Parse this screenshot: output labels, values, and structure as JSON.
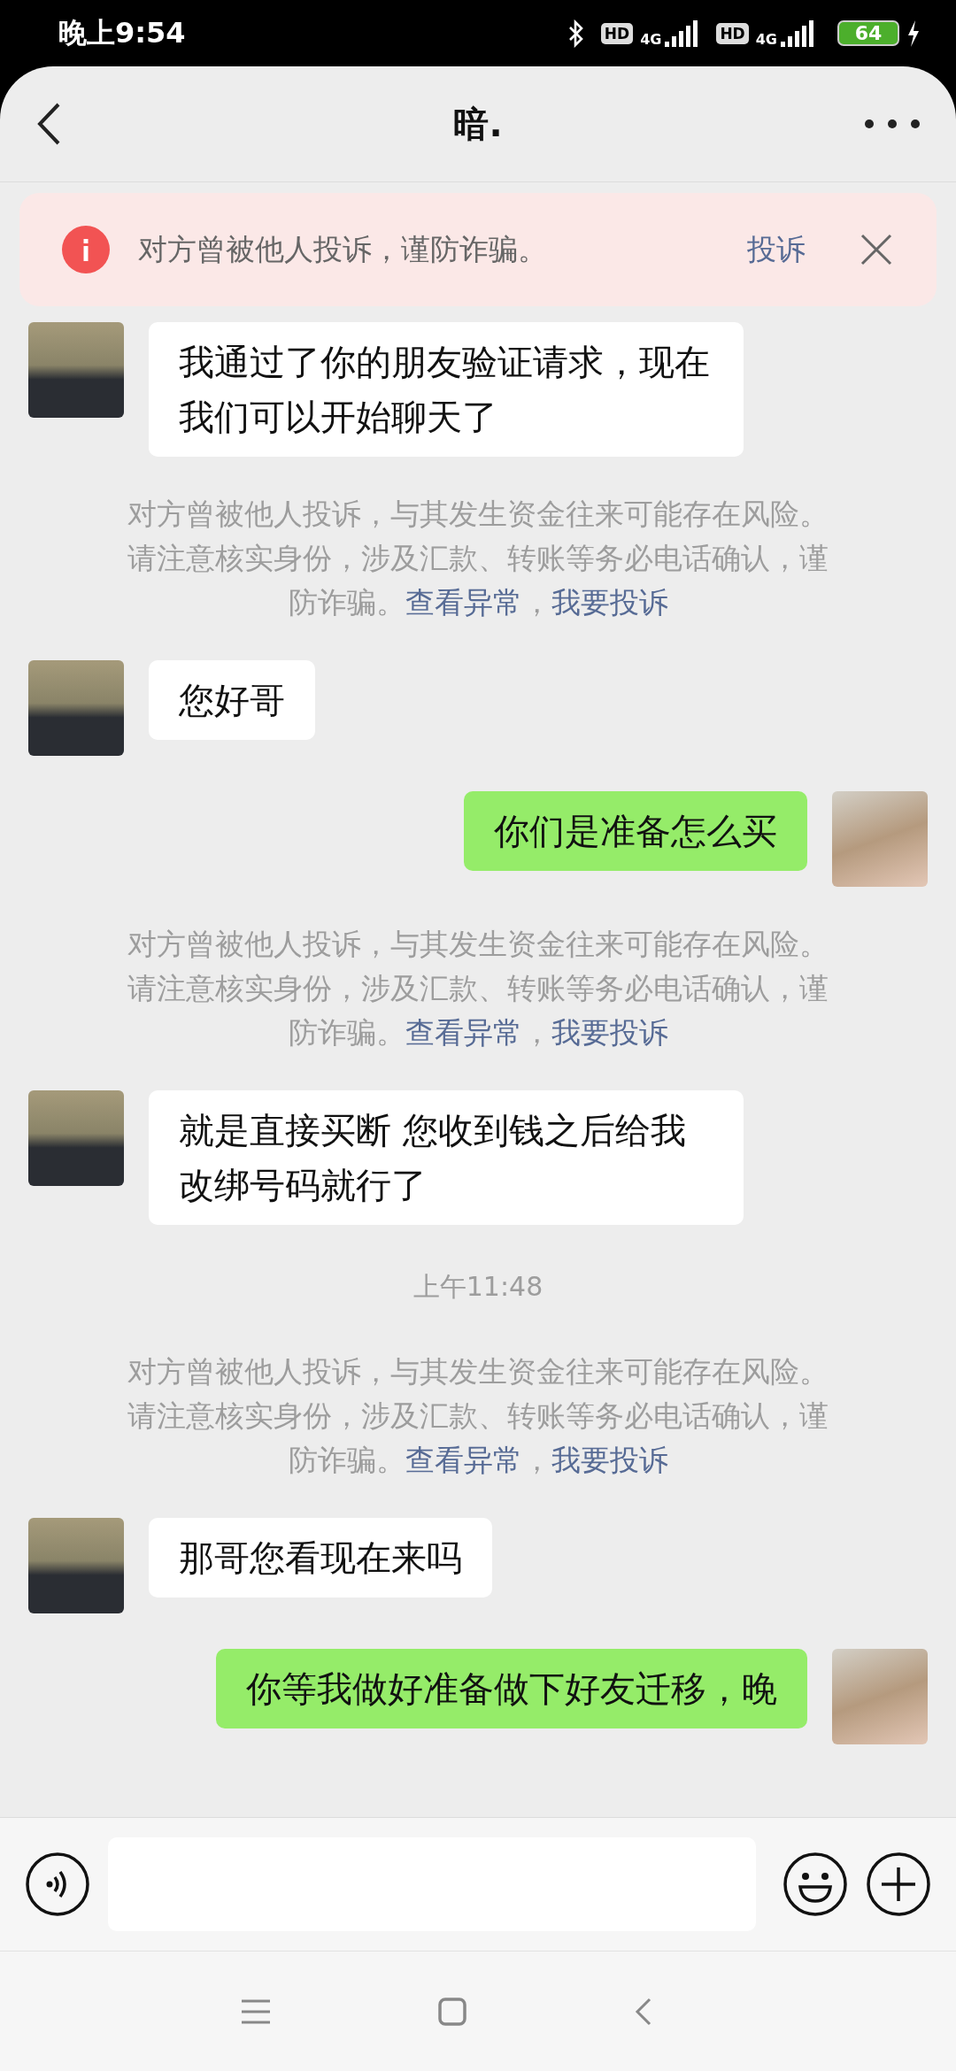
{
  "status_bar": {
    "time": "晚上9:54",
    "sims": [
      {
        "hd": "HD",
        "network": "4G"
      },
      {
        "hd": "HD",
        "network": "4G"
      }
    ],
    "battery": "64"
  },
  "header": {
    "title": "暗."
  },
  "banner": {
    "text": "对方曾被他人投诉，谨防诈骗。",
    "action": "投诉"
  },
  "messages": [
    {
      "kind": "received",
      "text": "我通过了你的朋友验证请求，现在我们可以开始聊天了"
    },
    {
      "kind": "notice",
      "text": "对方曾被他人投诉，与其发生资金往来可能存在风险。请注意核实身份，涉及汇款、转账等务必电话确认，谨防诈骗。",
      "links": [
        "查看异常",
        "我要投诉"
      ],
      "separator": "，"
    },
    {
      "kind": "received",
      "text": "您好哥"
    },
    {
      "kind": "sent",
      "text": "你们是准备怎么买"
    },
    {
      "kind": "notice",
      "text": "对方曾被他人投诉，与其发生资金往来可能存在风险。请注意核实身份，涉及汇款、转账等务必电话确认，谨防诈骗。",
      "links": [
        "查看异常",
        "我要投诉"
      ],
      "separator": "，"
    },
    {
      "kind": "received",
      "text": "就是直接买断 您收到钱之后给我改绑号码就行了"
    },
    {
      "kind": "time",
      "text": "上午11:48"
    },
    {
      "kind": "notice",
      "text": "对方曾被他人投诉，与其发生资金往来可能存在风险。请注意核实身份，涉及汇款、转账等务必电话确认，谨防诈骗。",
      "links": [
        "查看异常",
        "我要投诉"
      ],
      "separator": "，"
    },
    {
      "kind": "received",
      "text": "那哥您看现在来吗"
    },
    {
      "kind": "sent",
      "text": "你等我做好准备做下好友迁移，晚"
    }
  ]
}
